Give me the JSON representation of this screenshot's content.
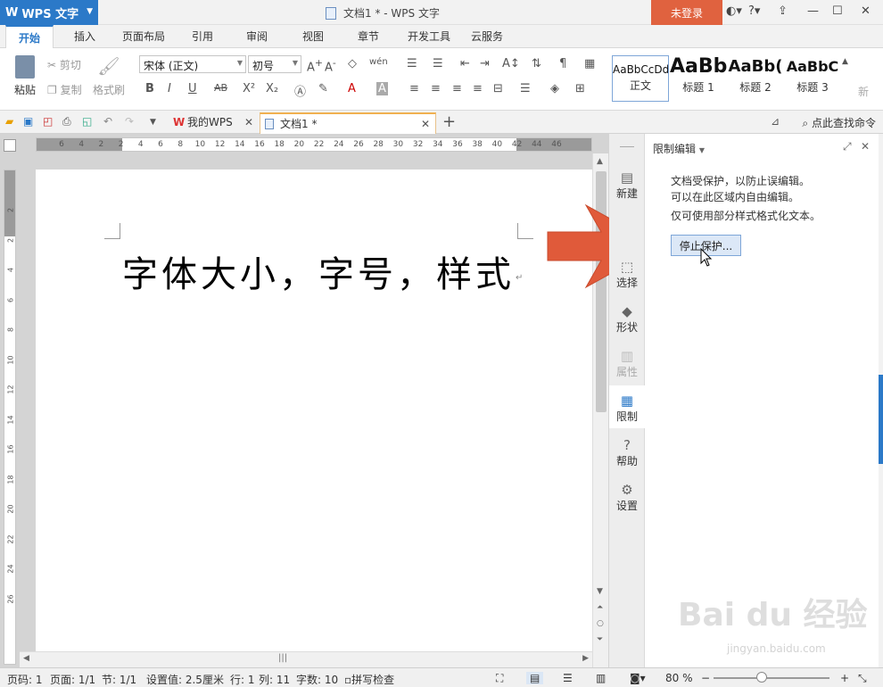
{
  "titlebar": {
    "app_name": "WPS 文字",
    "doc_title": "文档1 * - WPS 文字",
    "login": "未登录"
  },
  "tabs": [
    "开始",
    "插入",
    "页面布局",
    "引用",
    "审阅",
    "视图",
    "章节",
    "开发工具",
    "云服务"
  ],
  "ribbon": {
    "paste": "粘贴",
    "cut": "剪切",
    "copy": "复制",
    "format_painter": "格式刷",
    "font_name": "宋体 (正文)",
    "font_size": "初号",
    "styles": [
      {
        "sample": "AaBbCcDd",
        "label": "正文"
      },
      {
        "sample": "AaBb",
        "label": "标题 1"
      },
      {
        "sample": "AaBb(",
        "label": "标题 2"
      },
      {
        "sample": "AaBbC",
        "label": "标题 3"
      }
    ],
    "new_style": "新"
  },
  "quickbar": {
    "tab_mywps": "我的WPS",
    "tab_doc": "文档1 *",
    "search": "点此查找命令"
  },
  "ruler": {
    "h_ticks": [
      "6",
      "4",
      "2",
      "2",
      "4",
      "6",
      "8",
      "10",
      "12",
      "14",
      "16",
      "18",
      "20",
      "22",
      "24",
      "26",
      "28",
      "30",
      "32",
      "34",
      "36",
      "38",
      "40",
      "42",
      "44",
      "46"
    ],
    "v_ticks": [
      "2",
      "2",
      "4",
      "6",
      "8",
      "10",
      "12",
      "14",
      "16",
      "18",
      "20",
      "22",
      "24",
      "26"
    ]
  },
  "document": {
    "text": "字体大小，字号，样式",
    "para_mark": "↵"
  },
  "sidebar": {
    "items": [
      {
        "label": "新建",
        "icon": "new-doc-icon"
      },
      {
        "label": "选择",
        "icon": "select-icon"
      },
      {
        "label": "形状",
        "icon": "shape-icon"
      },
      {
        "label": "属性",
        "icon": "property-icon"
      },
      {
        "label": "限制",
        "icon": "restrict-icon"
      },
      {
        "label": "帮助",
        "icon": "help-icon"
      },
      {
        "label": "设置",
        "icon": "settings-icon"
      }
    ]
  },
  "pane": {
    "title": "限制编辑",
    "lines": [
      "文档受保护，以防止误编辑。",
      "可以在此区域内自由编辑。",
      "仅可使用部分样式格式化文本。"
    ],
    "stop_button": "停止保护..."
  },
  "statusbar": {
    "page_code": "页码: 1",
    "page": "页面: 1/1",
    "section": "节: 1/1",
    "setting": "设置值: 2.5厘米",
    "line": "行: 1",
    "col": "列: 11",
    "words": "字数: 10",
    "spellcheck": "拼写检查",
    "zoom": "80 %"
  },
  "watermark": {
    "main": "Bai du 经验",
    "sub": "jingyan.baidu.com"
  },
  "colors": {
    "accent": "#2b79c8",
    "login": "#e0623f",
    "arrow": "#e05a3a"
  }
}
